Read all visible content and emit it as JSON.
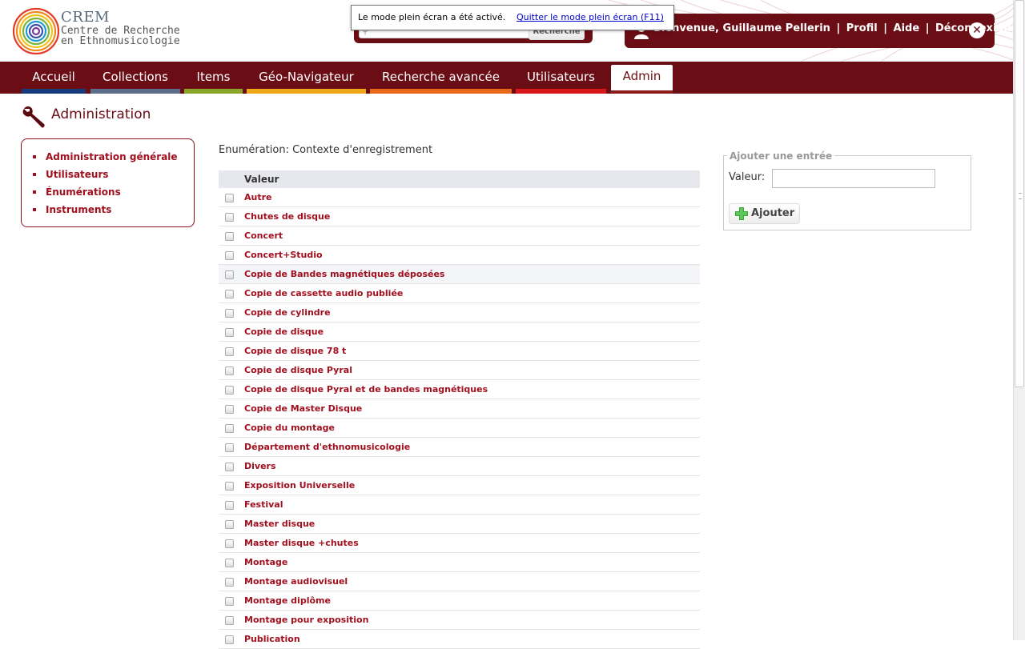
{
  "logo": {
    "acronym": "CREM",
    "line1": "Centre de Recherche",
    "line2": "en Ethnomusicologie"
  },
  "search": {
    "button_label": "Recherche",
    "icon": "search-icon"
  },
  "user": {
    "welcome": "Bienvenue, Guillaume Pellerin",
    "profile": "Profil",
    "help": "Aide",
    "logout": "Déconnexion",
    "separator": "|",
    "close_glyph": "✕"
  },
  "fullscreen_notice": {
    "text": "Le mode plein écran a été activé.",
    "link": "Quitter le mode plein écran (F11)"
  },
  "nav": {
    "tabs": [
      {
        "label": "Accueil",
        "color": "#163a7a"
      },
      {
        "label": "Collections",
        "color": "#5c6e8c"
      },
      {
        "label": "Items",
        "color": "#8aa62a"
      },
      {
        "label": "Géo-Navigateur",
        "color": "#f0a818"
      },
      {
        "label": "Recherche avancée",
        "color": "#e8681a"
      },
      {
        "label": "Utilisateurs",
        "color": "#d61818"
      },
      {
        "label": "Admin",
        "color": "#8b1a1a"
      }
    ],
    "active": "Admin"
  },
  "page_title": "Administration",
  "sidebar": {
    "items": [
      {
        "label": "Administration générale"
      },
      {
        "label": "Utilisateurs"
      },
      {
        "label": "Énumérations"
      },
      {
        "label": "Instruments"
      }
    ]
  },
  "enumeration": {
    "title": "Enumération: Contexte d'enregistrement",
    "column_header": "Valeur",
    "rows": [
      "Autre",
      "Chutes de disque",
      "Concert",
      "Concert+Studio",
      "Copie de Bandes magnétiques déposées",
      "Copie de cassette audio publiée",
      "Copie de cylindre",
      "Copie de disque",
      "Copie de disque 78 t",
      "Copie de disque Pyral",
      "Copie de disque Pyral et de bandes magnétiques",
      "Copie de Master Disque",
      "Copie du montage",
      "Département d'ethnomusicologie",
      "Divers",
      "Exposition Universelle",
      "Festival",
      "Master disque",
      "Master disque +chutes",
      "Montage",
      "Montage audiovisuel",
      "Montage diplôme",
      "Montage pour exposition",
      "Publication"
    ],
    "highlighted_row": "Copie de Bandes magnétiques déposées"
  },
  "add_entry": {
    "legend": "Ajouter une entrée",
    "value_label": "Valeur:",
    "value": "",
    "button_label": "Ajouter"
  },
  "colors": {
    "brand": "#6a0d15",
    "link": "#a0101e"
  }
}
